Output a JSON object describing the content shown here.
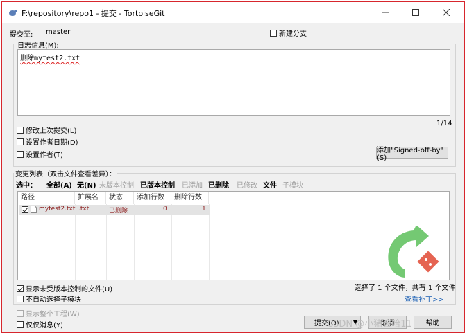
{
  "window": {
    "title": "F:\\repository\\repo1 - 提交 - TortoiseGit"
  },
  "commit_to": {
    "label": "提交至:",
    "branch": "master"
  },
  "new_branch": {
    "label": "新建分支",
    "checked": false
  },
  "log": {
    "label": "日志信息(M):",
    "text": "删除mytest2.txt",
    "counter": "1/14"
  },
  "options": {
    "amend": "修改上次提交(L)",
    "set_date": "设置作者日期(D)",
    "set_author": "设置作者(T)"
  },
  "signed_off_button": "添加\"Signed-off-by\"(S)",
  "changes": {
    "label": "变更列表（双击文件查看差异）：",
    "select_label": "选中：",
    "filters": [
      {
        "label": "全部(A)",
        "style": "bold"
      },
      {
        "label": "无(N)",
        "style": "bold"
      },
      {
        "label": "未版本控制",
        "style": "gray"
      },
      {
        "label": "已版本控制",
        "style": "bold"
      },
      {
        "label": "已添加",
        "style": "gray"
      },
      {
        "label": "已删除",
        "style": "bold"
      },
      {
        "label": "已修改",
        "style": "gray"
      },
      {
        "label": "文件",
        "style": "bold"
      },
      {
        "label": "子模块",
        "style": "gray"
      }
    ],
    "columns": [
      "路径",
      "扩展名",
      "状态",
      "添加行数",
      "删除行数"
    ],
    "rows": [
      {
        "checked": true,
        "path": "mytest2.txt",
        "ext": ".txt",
        "status": "已删除",
        "added": "0",
        "deleted": "1"
      }
    ]
  },
  "bottom": {
    "show_unversioned": "显示未受版本控制的文件(U)",
    "no_auto_submodule": "不自动选择子模块",
    "show_whole_project": "显示整个工程(W)",
    "message_only": "仅仅消息(Y)",
    "selection_status": "选择了 1 个文件，共有 1 个文件",
    "view_patch": "查看补丁>>",
    "commit_button": "提交(O)",
    "cancel_button": "取消",
    "help_button": "帮助"
  },
  "watermark": "CSDN @小猪会哈11",
  "colors": {
    "accent_border": "#d7262d",
    "deleted_text": "#8b1a1a",
    "link": "#1a5fb4",
    "logo_green": "#5cbf5a"
  }
}
